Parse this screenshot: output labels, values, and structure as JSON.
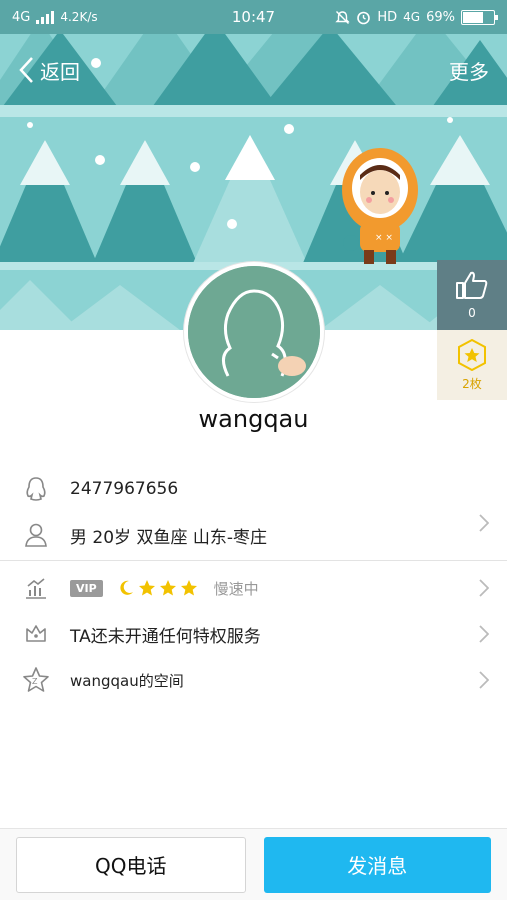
{
  "status_bar": {
    "network": "4G",
    "speed": "4.2K/s",
    "time": "10:47",
    "hd": "HD",
    "network2": "4G",
    "battery": "69%",
    "battery_level": 0.69
  },
  "nav": {
    "back_label": "返回",
    "more_label": "更多"
  },
  "likes": {
    "count": "0"
  },
  "coins": {
    "label": "2枚"
  },
  "profile": {
    "username": "wangqau"
  },
  "info": {
    "qq_number": "2477967656",
    "details": "男  20岁  双鱼座  山东-枣庄"
  },
  "vip_row": {
    "badge": "VIP",
    "status": "慢速中"
  },
  "privilege_row": {
    "label": "TA还未开通任何特权服务"
  },
  "space_row": {
    "label": "wangqau的空间"
  },
  "actions": {
    "call_label": "QQ电话",
    "message_label": "发消息"
  },
  "colors": {
    "accent": "#1fb8f0",
    "banner": "#8cd3d3",
    "tree_dark": "#3f9ea0",
    "tree_light": "#a8dede",
    "coin": "#f2c200"
  }
}
